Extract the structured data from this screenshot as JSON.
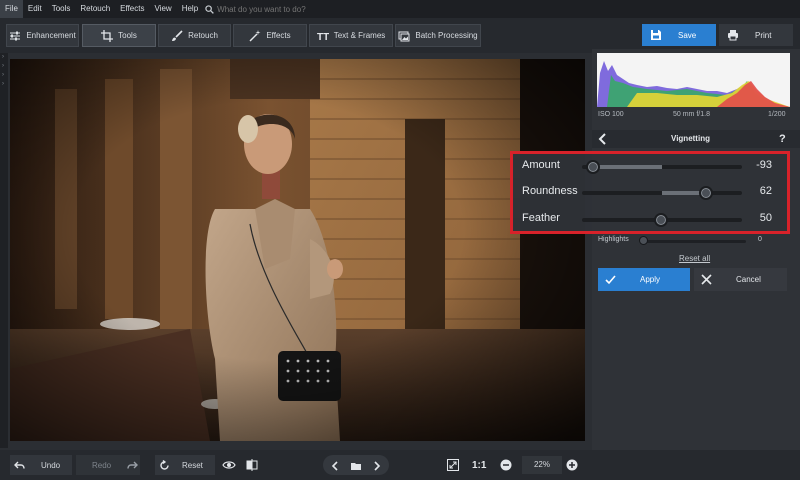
{
  "menu": {
    "items": [
      "File",
      "Edit",
      "Tools",
      "Retouch",
      "Effects",
      "View",
      "Help"
    ],
    "search_placeholder": "What do you want to do?"
  },
  "toolbar": {
    "tabs": [
      "Enhancement",
      "Tools",
      "Retouch",
      "Effects",
      "Text & Frames",
      "Batch Processing"
    ],
    "active_tab": "Tools",
    "save_label": "Save",
    "print_label": "Print"
  },
  "histogram": {
    "iso": "ISO 100",
    "lens": "50 mm f/1.8",
    "shutter": "1/200"
  },
  "panel": {
    "title": "Vignetting",
    "help": "?",
    "sliders": [
      {
        "label": "Amount",
        "value": "-93",
        "position": 0.07
      },
      {
        "label": "Roundness",
        "value": "62",
        "position": 0.79
      },
      {
        "label": "Feather",
        "value": "50",
        "position": 0.5
      }
    ],
    "highlights": {
      "label": "Highlights",
      "value": "0",
      "position": 0.0
    },
    "reset_all": "Reset all",
    "apply_label": "Apply",
    "cancel_label": "Cancel"
  },
  "bottom": {
    "undo": "Undo",
    "redo": "Redo",
    "reset": "Reset",
    "ratio": "1:1",
    "zoom": "22%"
  },
  "colors": {
    "accent": "#2a7fd1",
    "highlight_box": "#d8222a"
  }
}
